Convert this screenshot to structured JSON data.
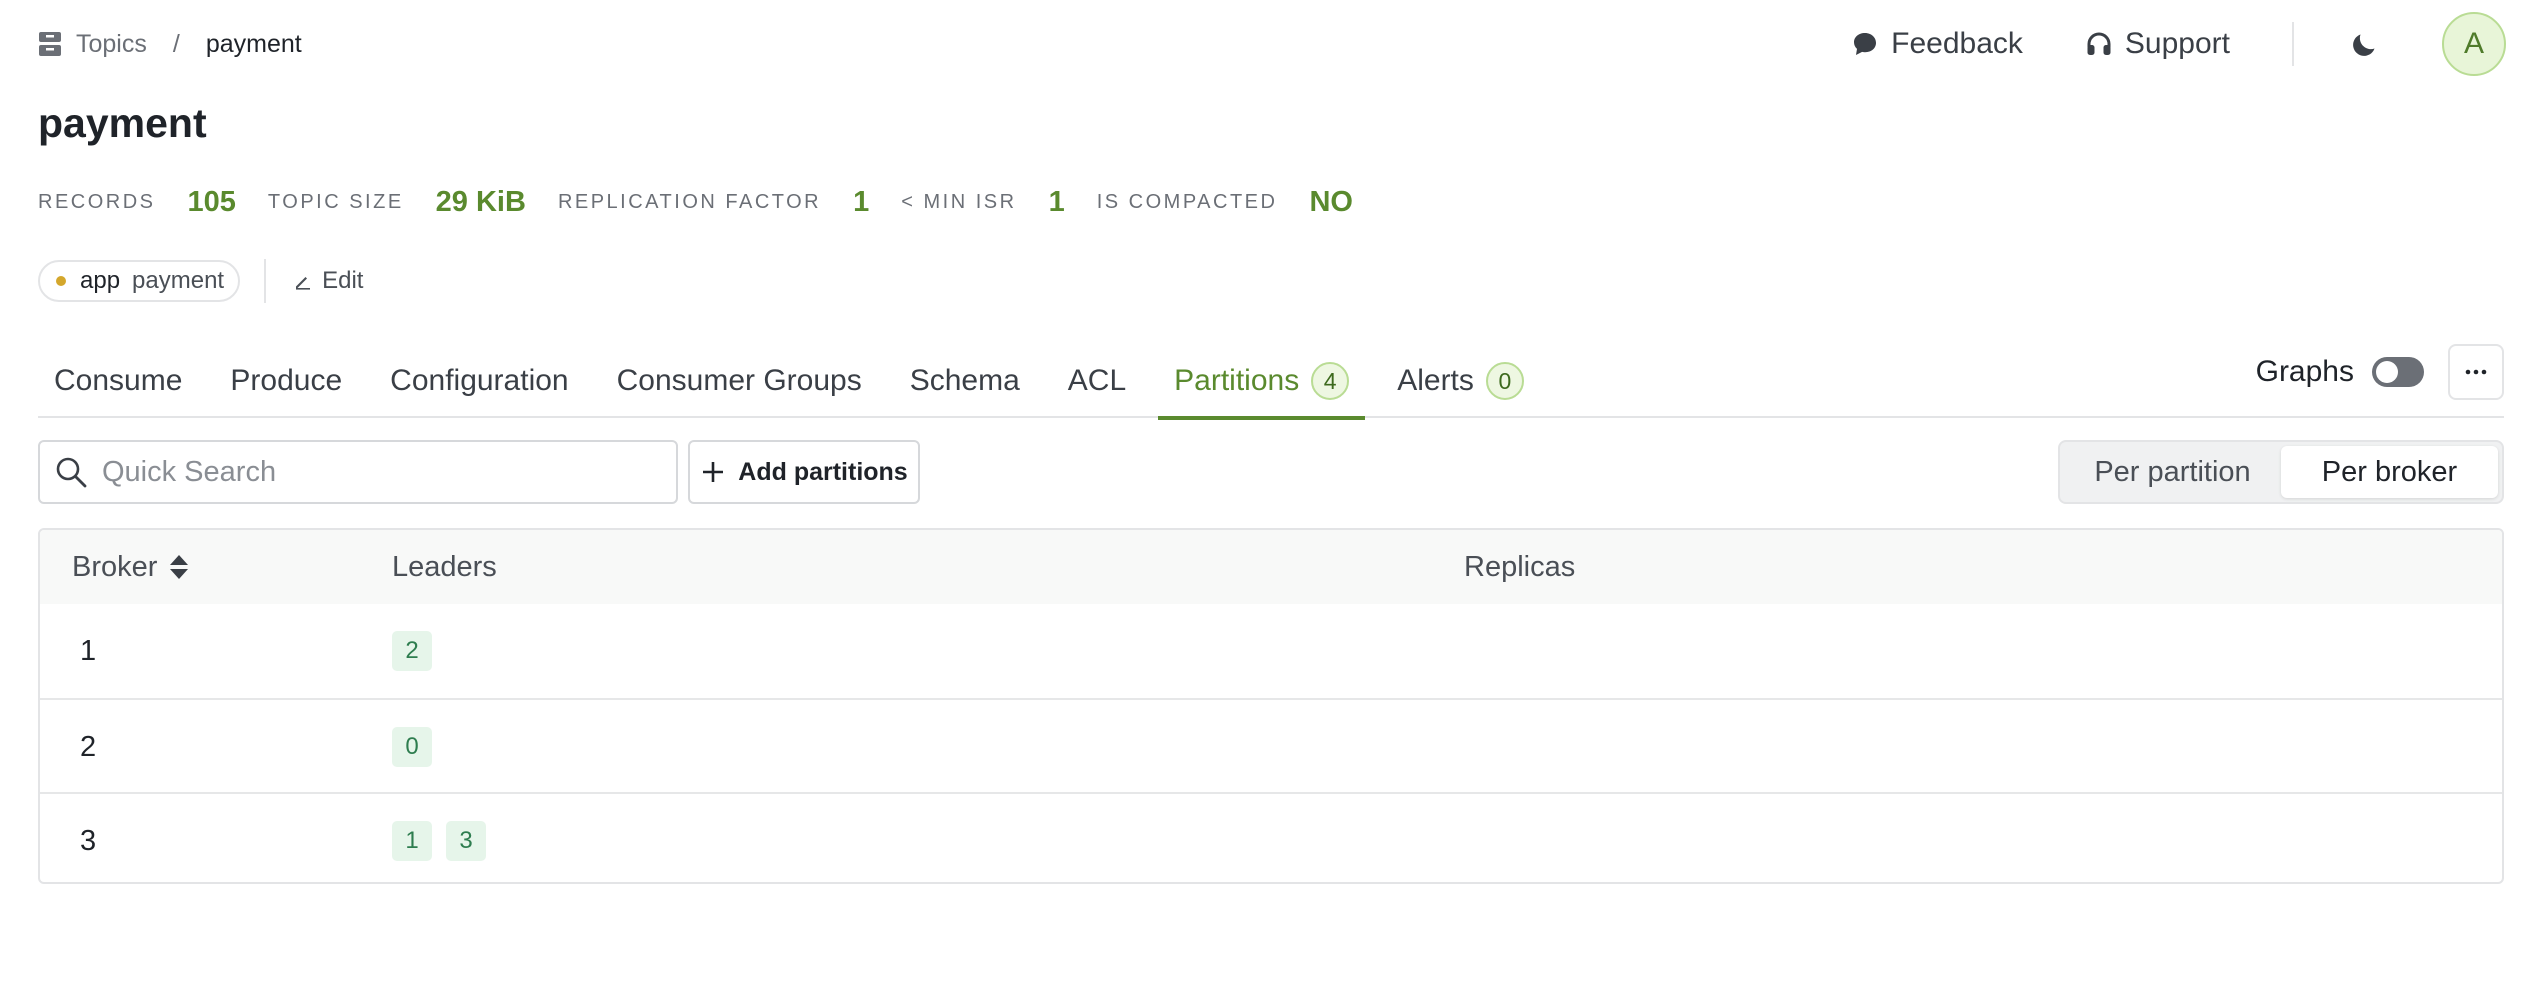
{
  "breadcrumb": {
    "parent": "Topics",
    "separator": "/",
    "current": "payment"
  },
  "header": {
    "feedback_label": "Feedback",
    "support_label": "Support",
    "avatar_initial": "A"
  },
  "topic": {
    "title": "payment",
    "stats": [
      {
        "label": "RECORDS",
        "value": "105"
      },
      {
        "label": "TOPIC SIZE",
        "value": "29 KiB"
      },
      {
        "label": "REPLICATION FACTOR",
        "value": "1"
      },
      {
        "label": "< MIN ISR",
        "value": "1"
      },
      {
        "label": "IS COMPACTED",
        "value": "NO"
      }
    ],
    "label": {
      "key": "app",
      "value": "payment"
    },
    "edit_label": "Edit"
  },
  "tabs": [
    {
      "label": "Consume"
    },
    {
      "label": "Produce"
    },
    {
      "label": "Configuration"
    },
    {
      "label": "Consumer Groups"
    },
    {
      "label": "Schema"
    },
    {
      "label": "ACL"
    },
    {
      "label": "Partitions",
      "count": "4",
      "active": true
    },
    {
      "label": "Alerts",
      "count": "0"
    }
  ],
  "graphs": {
    "label": "Graphs",
    "enabled": false
  },
  "toolbar": {
    "search_placeholder": "Quick Search",
    "search_value": "",
    "add_label": "Add partitions",
    "view_options": [
      "Per partition",
      "Per broker"
    ],
    "view_selected": "Per broker"
  },
  "table": {
    "columns": [
      "Broker",
      "Leaders",
      "Replicas"
    ],
    "rows": [
      {
        "broker": "1",
        "leaders": [
          "2"
        ],
        "replicas": []
      },
      {
        "broker": "2",
        "leaders": [
          "0"
        ],
        "replicas": []
      },
      {
        "broker": "3",
        "leaders": [
          "1",
          "3"
        ],
        "replicas": []
      }
    ]
  },
  "colors": {
    "accent": "#5a8a2e",
    "badge_bg": "#e6f5ea",
    "badge_text": "#2e7d4f",
    "label_dot": "#d4a72c"
  }
}
